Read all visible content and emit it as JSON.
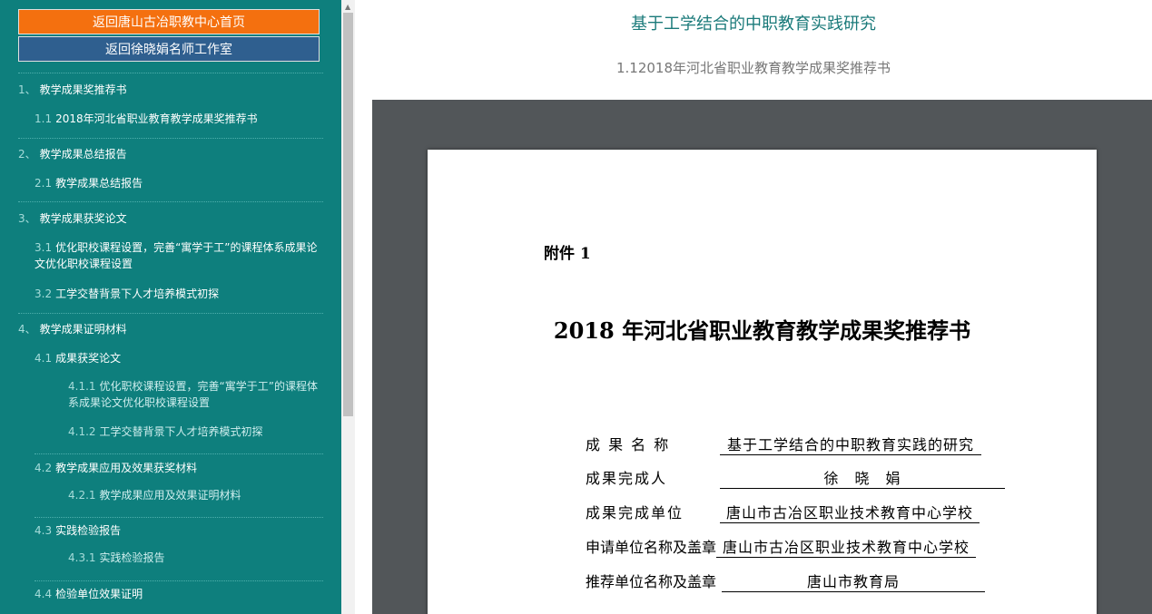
{
  "sidebar": {
    "home_button": "返回唐山古冶职教中心首页",
    "studio_button": "返回徐晓娟名师工作室",
    "items": [
      {
        "num": "1、",
        "label": "教学成果奖推荐书"
      },
      {
        "num": "1.1",
        "label": "2018年河北省职业教育教学成果奖推荐书"
      },
      {
        "num": "2、",
        "label": "教学成果总结报告"
      },
      {
        "num": "2.1",
        "label": "教学成果总结报告"
      },
      {
        "num": "3、",
        "label": "教学成果获奖论文"
      },
      {
        "num": "3.1",
        "label": "优化职校课程设置，完善“寓学于工”的课程体系成果论文优化职校课程设置"
      },
      {
        "num": "3.2",
        "label": "工学交替背景下人才培养模式初探"
      },
      {
        "num": "4、",
        "label": "教学成果证明材料"
      },
      {
        "num": "4.1",
        "label": "成果获奖论文"
      },
      {
        "num": "4.1.1",
        "label": "优化职校课程设置，完善“寓学于工”的课程体系成果论文优化职校课程设置"
      },
      {
        "num": "4.1.2",
        "label": "工学交替背景下人才培养模式初探"
      },
      {
        "num": "4.2",
        "label": "教学成果应用及效果获奖材料"
      },
      {
        "num": "4.2.1",
        "label": "教学成果应用及效果证明材料"
      },
      {
        "num": "4.3",
        "label": "实践检验报告"
      },
      {
        "num": "4.3.1",
        "label": "实践检验报告"
      },
      {
        "num": "4.4",
        "label": "检验单位效果证明"
      }
    ]
  },
  "main": {
    "title": "基于工学结合的中职教育实践研究",
    "subtitle": "1.12018年河北省职业教育教学成果奖推荐书"
  },
  "document": {
    "attachment": "附件 1",
    "title": "2018 年河北省职业教育教学成果奖推荐书",
    "fields": [
      {
        "label": "成 果 名 称",
        "value": "基于工学结合的中职教育实践的研究"
      },
      {
        "label": "成果完成人",
        "value": "徐　晓　娟"
      },
      {
        "label": "成果完成单位",
        "value": "唐山市古冶区职业技术教育中心学校"
      },
      {
        "label": "申请单位名称及盖章",
        "value": "唐山市古冶区职业技术教育中心学校"
      },
      {
        "label": "推荐单位名称及盖章",
        "value": "唐山市教育局"
      }
    ]
  },
  "colors": {
    "sidebar_bg": "#0e7f7d",
    "home_button_bg": "#f4700f",
    "studio_button_bg": "#2f5f8f",
    "viewer_bg": "#525659",
    "title_color": "#1a7a7a"
  },
  "icons": {
    "scroll_up": "chevron-up-icon"
  }
}
